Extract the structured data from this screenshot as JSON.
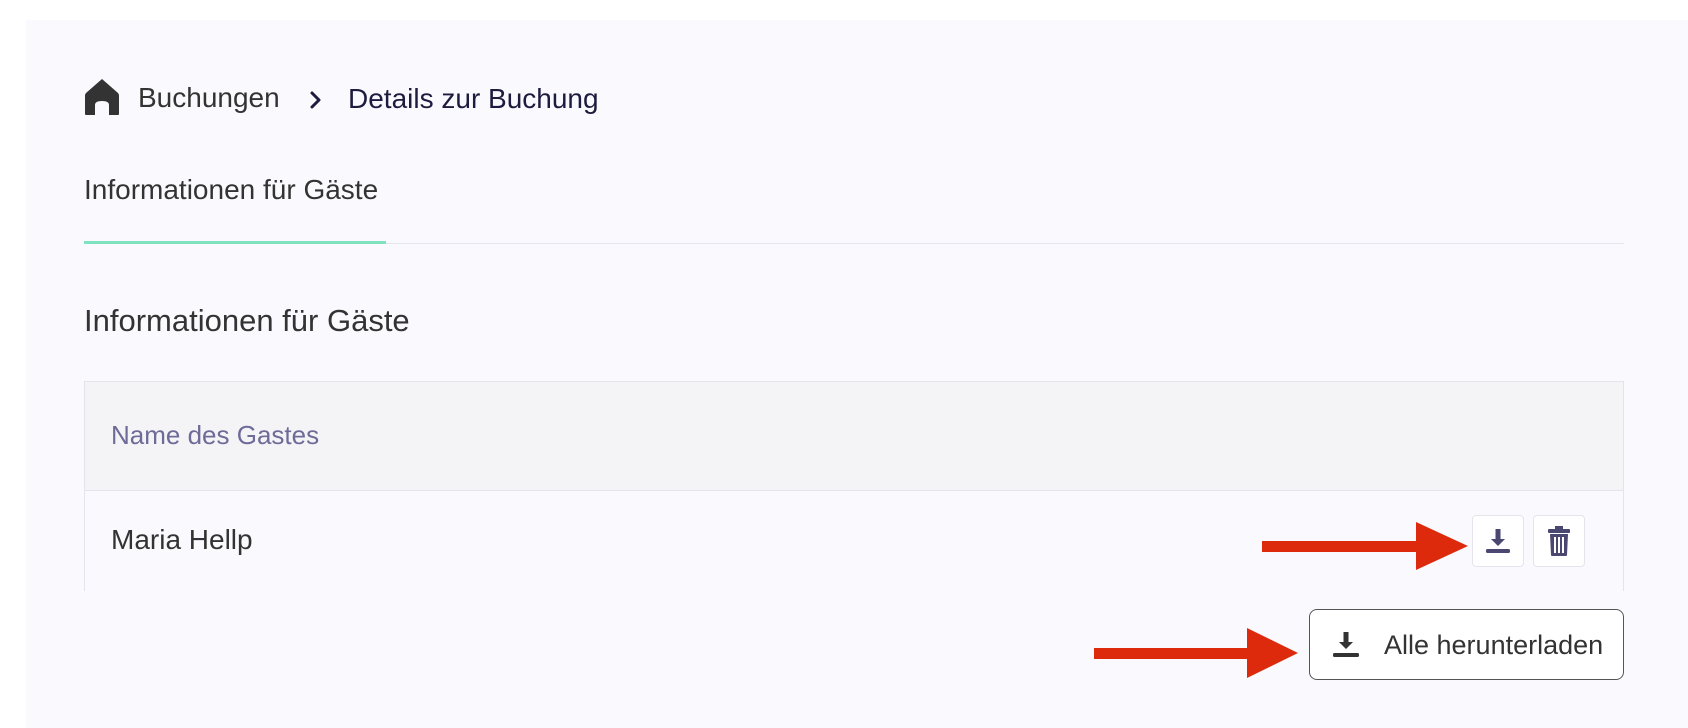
{
  "breadcrumb": {
    "home_icon": "home-icon",
    "items": [
      "Buchungen",
      "Details zur Buchung"
    ],
    "separator_icon": "chevron-right-icon"
  },
  "tabs": [
    {
      "label": "Informationen für Gäste",
      "active": true
    }
  ],
  "section": {
    "title": "Informationen für Gäste"
  },
  "table": {
    "columns": [
      "Name des Gastes"
    ],
    "rows": [
      {
        "name": "Maria Hellp",
        "actions": [
          "download-icon",
          "trash-icon"
        ]
      }
    ]
  },
  "download_all": {
    "label": "Alle herunterladen",
    "icon": "download-icon"
  },
  "colors": {
    "accent": "#7fe3bf",
    "header_text": "#6e6b98",
    "annotation_arrow": "#dd2a0c",
    "icon": "#4a4870"
  }
}
